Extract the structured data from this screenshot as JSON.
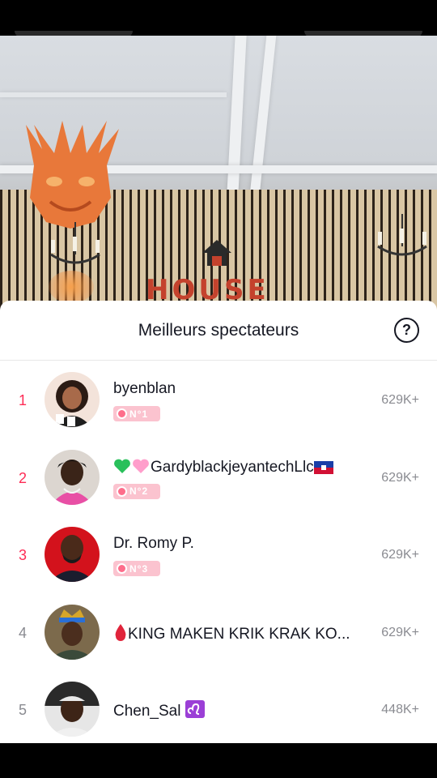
{
  "sheet": {
    "title": "Meilleurs spectateurs",
    "help_icon": "?"
  },
  "video_sign": "HOUSE",
  "colors": {
    "accent": "#fe2c55",
    "badge": "#fbc3cf",
    "muted": "#8a8b91",
    "text": "#161823"
  },
  "viewers": [
    {
      "rank": "1",
      "name": "byenblan",
      "badge": "N°1",
      "score": "629K+"
    },
    {
      "rank": "2",
      "name_prefix_icons": [
        "green-heart",
        "pink-heart"
      ],
      "name": "GardyblackjeyantechLlc",
      "name_suffix_icon": "haiti-flag",
      "badge": "N°2",
      "score": "629K+"
    },
    {
      "rank": "3",
      "name": "Dr. Romy P.",
      "badge": "N°3",
      "score": "629K+"
    },
    {
      "rank": "4",
      "name_prefix_icons": [
        "red-drop"
      ],
      "name": "KING MAKEN KRIK KRAK KO...",
      "score": "629K+"
    },
    {
      "rank": "5",
      "name": "Chen_Sal",
      "name_suffix_icon": "leo-zodiac",
      "score": "448K+"
    }
  ]
}
